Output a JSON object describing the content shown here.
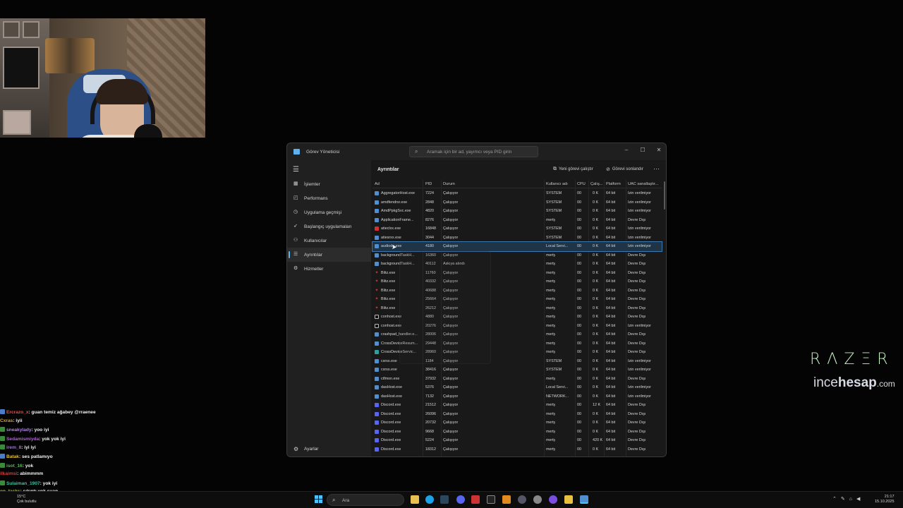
{
  "window": {
    "title": "Görev Yöneticisi",
    "search_placeholder": "Aramak için bir ad, yayımcı veya PID girin",
    "minimize": "–",
    "maximize": "☐",
    "close": "✕"
  },
  "nav": {
    "items": [
      {
        "label": "İşlemler",
        "icon": "grid-icon"
      },
      {
        "label": "Performans",
        "icon": "performance-icon"
      },
      {
        "label": "Uygulama geçmişi",
        "icon": "history-icon"
      },
      {
        "label": "Başlangıç uygulamaları",
        "icon": "startup-icon"
      },
      {
        "label": "Kullanıcılar",
        "icon": "users-icon"
      },
      {
        "label": "Ayrıntılar",
        "icon": "details-icon"
      },
      {
        "label": "Hizmetler",
        "icon": "services-icon"
      }
    ],
    "active": "Ayrıntılar",
    "settings": "Ayarlar"
  },
  "main": {
    "title": "Ayrıntılar",
    "new_task": "Yeni görevi çalıştır",
    "end_task": "Görevi sonlandır",
    "more": "⋯"
  },
  "columns": [
    "Ad",
    "PID",
    "Durum",
    "Kullanıcı adı",
    "CPU",
    "Çalış...",
    "Platform",
    "UAC sanallaştır..."
  ],
  "rows": [
    {
      "name": "AggregatorHost.exe",
      "pid": "7224",
      "status": "Çalışıyor",
      "user": "SYSTEM",
      "cpu": "00",
      "mem": "0 K",
      "platform": "64 bit",
      "uac": "İzin verilmiyor",
      "icon": "app"
    },
    {
      "name": "amdfendrsr.exe",
      "pid": "2848",
      "status": "Çalışıyor",
      "user": "SYSTEM",
      "cpu": "00",
      "mem": "0 K",
      "platform": "64 bit",
      "uac": "İzin verilmiyor",
      "icon": "app"
    },
    {
      "name": "AmdPpkgSvc.exe",
      "pid": "4820",
      "status": "Çalışıyor",
      "user": "SYSTEM",
      "cpu": "00",
      "mem": "0 K",
      "platform": "64 bit",
      "uac": "İzin verilmiyor",
      "icon": "app"
    },
    {
      "name": "ApplicationFrame...",
      "pid": "8276",
      "status": "Çalışıyor",
      "user": "merty",
      "cpu": "00",
      "mem": "0 K",
      "platform": "64 bit",
      "uac": "Devre Dışı",
      "icon": "app"
    },
    {
      "name": "atieclxx.exe",
      "pid": "16848",
      "status": "Çalışıyor",
      "user": "SYSTEM",
      "cpu": "00",
      "mem": "0 K",
      "platform": "64 bit",
      "uac": "İzin verilmiyor",
      "icon": "red"
    },
    {
      "name": "atiesrxx.exe",
      "pid": "3044",
      "status": "Çalışıyor",
      "user": "SYSTEM",
      "cpu": "00",
      "mem": "0 K",
      "platform": "64 bit",
      "uac": "İzin verilmiyor",
      "icon": "app"
    },
    {
      "name": "audiodg.exe",
      "pid": "4180",
      "status": "Çalışıyor",
      "user": "Local Servi...",
      "cpu": "00",
      "mem": "0 K",
      "platform": "64 bit",
      "uac": "İzin verilmiyor",
      "icon": "app",
      "selected": true
    },
    {
      "name": "backgroundTaskH...",
      "pid": "16360",
      "status": "Çalışıyor",
      "user": "merty",
      "cpu": "00",
      "mem": "0 K",
      "platform": "64 bit",
      "uac": "Devre Dışı",
      "icon": "app"
    },
    {
      "name": "backgroundTaskH...",
      "pid": "40112",
      "status": "Askıya alındı",
      "user": "merty",
      "cpu": "00",
      "mem": "0 K",
      "platform": "64 bit",
      "uac": "Devre Dışı",
      "icon": "app"
    },
    {
      "name": "Blitz.exe",
      "pid": "11760",
      "status": "Çalışıyor",
      "user": "merty",
      "cpu": "00",
      "mem": "0 K",
      "platform": "64 bit",
      "uac": "Devre Dışı",
      "icon": "redd"
    },
    {
      "name": "Blitz.exe",
      "pid": "40332",
      "status": "Çalışıyor",
      "user": "merty",
      "cpu": "00",
      "mem": "0 K",
      "platform": "64 bit",
      "uac": "Devre Dışı",
      "icon": "redd"
    },
    {
      "name": "Blitz.exe",
      "pid": "40688",
      "status": "Çalışıyor",
      "user": "merty",
      "cpu": "00",
      "mem": "0 K",
      "platform": "64 bit",
      "uac": "Devre Dışı",
      "icon": "redd"
    },
    {
      "name": "Blitz.exe",
      "pid": "25664",
      "status": "Çalışıyor",
      "user": "merty",
      "cpu": "00",
      "mem": "0 K",
      "platform": "64 bit",
      "uac": "Devre Dışı",
      "icon": "redd"
    },
    {
      "name": "Blitz.exe",
      "pid": "26212",
      "status": "Çalışıyor",
      "user": "merty",
      "cpu": "00",
      "mem": "0 K",
      "platform": "64 bit",
      "uac": "Devre Dışı",
      "icon": "redd"
    },
    {
      "name": "conhost.exe",
      "pid": "4880",
      "status": "Çalışıyor",
      "user": "merty",
      "cpu": "00",
      "mem": "0 K",
      "platform": "64 bit",
      "uac": "Devre Dışı",
      "icon": "con"
    },
    {
      "name": "conhost.exe",
      "pid": "20276",
      "status": "Çalışıyor",
      "user": "merty",
      "cpu": "00",
      "mem": "0 K",
      "platform": "64 bit",
      "uac": "İzin verilmiyor",
      "icon": "con"
    },
    {
      "name": "crashpad_handler.e...",
      "pid": "28006",
      "status": "Çalışıyor",
      "user": "merty",
      "cpu": "00",
      "mem": "0 K",
      "platform": "64 bit",
      "uac": "Devre Dışı",
      "icon": "app"
    },
    {
      "name": "CrossDeviceResum...",
      "pid": "29448",
      "status": "Çalışıyor",
      "user": "merty",
      "cpu": "00",
      "mem": "0 K",
      "platform": "64 bit",
      "uac": "Devre Dışı",
      "icon": "app"
    },
    {
      "name": "CrossDeviceServic...",
      "pid": "28960",
      "status": "Çalışıyor",
      "user": "merty",
      "cpu": "00",
      "mem": "0 K",
      "platform": "64 bit",
      "uac": "Devre Dışı",
      "icon": "teal"
    },
    {
      "name": "csrss.exe",
      "pid": "1184",
      "status": "Çalışıyor",
      "user": "SYSTEM",
      "cpu": "00",
      "mem": "0 K",
      "platform": "64 bit",
      "uac": "İzin verilmiyor",
      "icon": "app"
    },
    {
      "name": "csrss.exe",
      "pid": "38416",
      "status": "Çalışıyor",
      "user": "SYSTEM",
      "cpu": "00",
      "mem": "0 K",
      "platform": "64 bit",
      "uac": "İzin verilmiyor",
      "icon": "app"
    },
    {
      "name": "ctfmon.exe",
      "pid": "37932",
      "status": "Çalışıyor",
      "user": "merty",
      "cpu": "00",
      "mem": "0 K",
      "platform": "64 bit",
      "uac": "Devre Dışı",
      "icon": "app"
    },
    {
      "name": "dasHost.exe",
      "pid": "5376",
      "status": "Çalışıyor",
      "user": "Local Servi...",
      "cpu": "00",
      "mem": "0 K",
      "platform": "64 bit",
      "uac": "İzin verilmiyor",
      "icon": "app"
    },
    {
      "name": "dasHost.exe",
      "pid": "7132",
      "status": "Çalışıyor",
      "user": "NETWORK...",
      "cpu": "00",
      "mem": "0 K",
      "platform": "64 bit",
      "uac": "İzin verilmiyor",
      "icon": "app"
    },
    {
      "name": "Discord.exe",
      "pid": "21512",
      "status": "Çalışıyor",
      "user": "merty",
      "cpu": "00",
      "mem": "12 K",
      "platform": "64 bit",
      "uac": "Devre Dışı",
      "icon": "disc"
    },
    {
      "name": "Discord.exe",
      "pid": "26096",
      "status": "Çalışıyor",
      "user": "merty",
      "cpu": "00",
      "mem": "0 K",
      "platform": "64 bit",
      "uac": "Devre Dışı",
      "icon": "disc"
    },
    {
      "name": "Discord.exe",
      "pid": "20732",
      "status": "Çalışıyor",
      "user": "merty",
      "cpu": "00",
      "mem": "0 K",
      "platform": "64 bit",
      "uac": "Devre Dışı",
      "icon": "disc"
    },
    {
      "name": "Discord.exe",
      "pid": "9668",
      "status": "Çalışıyor",
      "user": "merty",
      "cpu": "00",
      "mem": "0 K",
      "platform": "64 bit",
      "uac": "Devre Dışı",
      "icon": "disc"
    },
    {
      "name": "Discord.exe",
      "pid": "5224",
      "status": "Çalışıyor",
      "user": "merty",
      "cpu": "00",
      "mem": "420 K",
      "platform": "64 bit",
      "uac": "Devre Dışı",
      "icon": "disc"
    },
    {
      "name": "Discord.exe",
      "pid": "18312",
      "status": "Çalışıyor",
      "user": "merty",
      "cpu": "00",
      "mem": "0 K",
      "platform": "64 bit",
      "uac": "Devre Dışı",
      "icon": "disc"
    }
  ],
  "overlay": {
    "razer": "RΛZΞR",
    "brand_light": "ince",
    "brand_bold": "hesap",
    "brand_tld": ".com"
  },
  "chat": [
    {
      "user": "Ercrazo_x",
      "msg": ": guan temiz ağabey @rraenee",
      "color": "#e05050",
      "badge": "#4a7cc7"
    },
    {
      "user": "Cxras",
      "msg": ": iyii",
      "color": "#e0a030",
      "badge": ""
    },
    {
      "user": "sneakylady",
      "msg": ": yoo iyi",
      "color": "#b080e0",
      "badge": "#3a8a3a"
    },
    {
      "user": "Sedamismiyda",
      "msg": ": yok yok iyi",
      "color": "#b060d0",
      "badge": "#3a8a3a"
    },
    {
      "user": "irem_8",
      "msg": ": iyi iyi",
      "color": "#a070e0",
      "badge": "#3a8a3a"
    },
    {
      "user": "Batak",
      "msg": ": ses patlamıyo",
      "color": "#e0c040",
      "badge": "#4a7cc7"
    },
    {
      "user": "isot_16",
      "msg": ": yok",
      "color": "#50c050",
      "badge": "#3a8a3a"
    },
    {
      "user": "ilkaimsi",
      "msg": ": abimmmm",
      "color": "#d04040",
      "badge": ""
    },
    {
      "user": "Sulaiman_1907",
      "msg": ": yok iyi",
      "color": "#40c0a0",
      "badge": "#3a8a3a"
    },
    {
      "user": "on_tasks",
      "msg": ": sıkıntı yok şuan",
      "color": "#c0c040",
      "badge": ""
    }
  ],
  "taskbar": {
    "weather_temp": "15°C",
    "weather_desc": "Çok bulutlu",
    "search": "Ara",
    "time": "21:17",
    "date": "15.10.2025"
  }
}
